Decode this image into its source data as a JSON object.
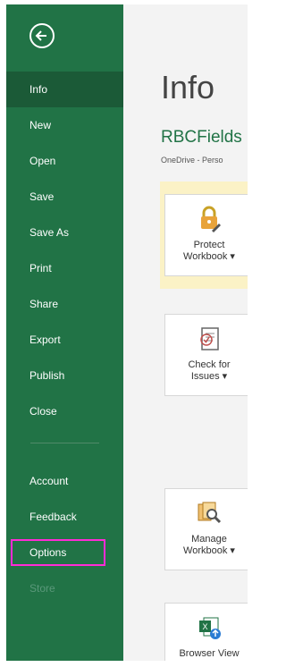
{
  "sidebar": {
    "back_label": "Back",
    "items": [
      {
        "label": "Info"
      },
      {
        "label": "New"
      },
      {
        "label": "Open"
      },
      {
        "label": "Save"
      },
      {
        "label": "Save As"
      },
      {
        "label": "Print"
      },
      {
        "label": "Share"
      },
      {
        "label": "Export"
      },
      {
        "label": "Publish"
      },
      {
        "label": "Close"
      },
      {
        "label": "Account"
      },
      {
        "label": "Feedback"
      },
      {
        "label": "Options"
      },
      {
        "label": "Store"
      }
    ],
    "active": "Info",
    "highlighted": "Options",
    "colors": {
      "background": "#217346",
      "active": "#1b5a37",
      "highlight": "#ff2bd6"
    }
  },
  "main": {
    "title": "Info",
    "workbook_name": "RBCFields",
    "location": "OneDrive - Perso",
    "cards": [
      {
        "name": "protect-workbook",
        "line1": "Protect",
        "line2": "Workbook ▾",
        "icon": "lock-icon"
      },
      {
        "name": "check-for-issues",
        "line1": "Check for",
        "line2": "Issues ▾",
        "icon": "document-check-icon"
      },
      {
        "name": "manage-workbook",
        "line1": "Manage",
        "line2": "Workbook ▾",
        "icon": "search-document-icon"
      },
      {
        "name": "browser-view",
        "line1": "Browser View",
        "line2": "",
        "icon": "excel-browser-icon"
      }
    ]
  }
}
